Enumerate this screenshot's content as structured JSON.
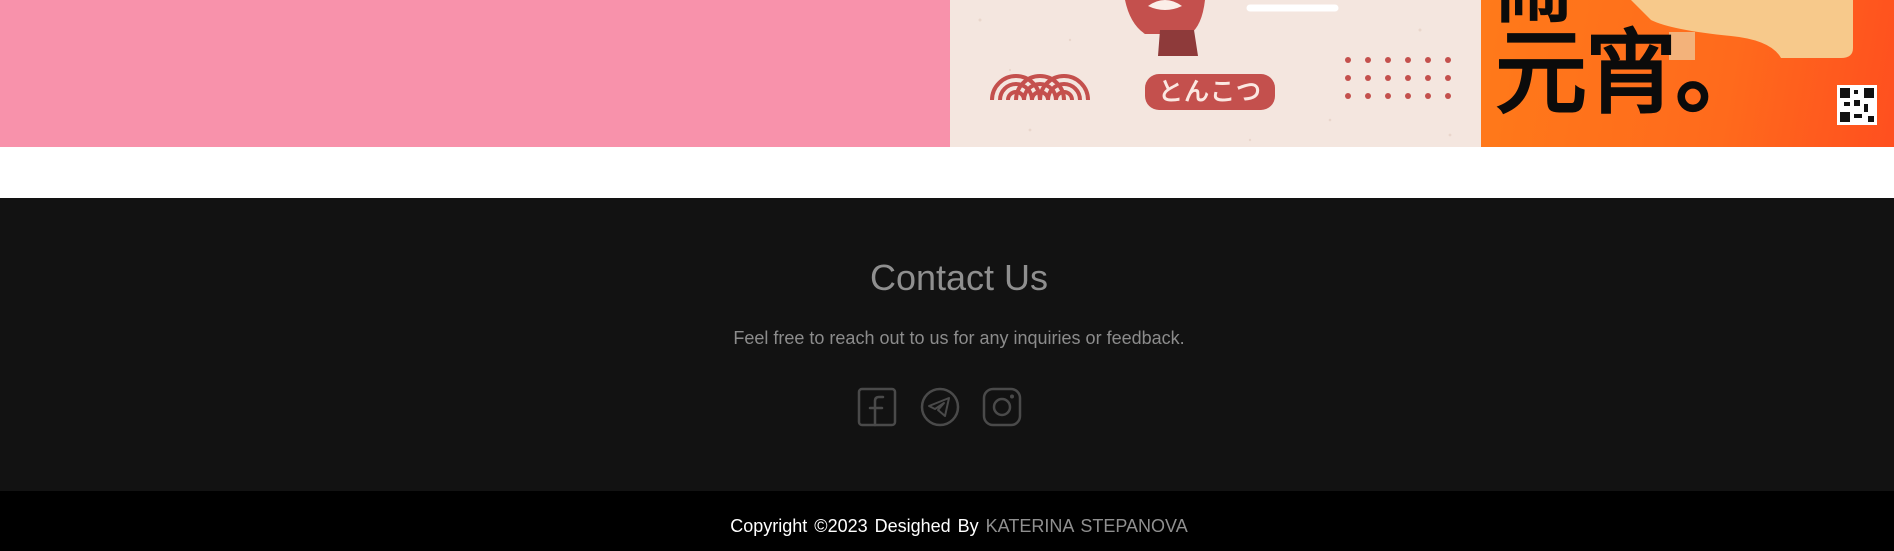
{
  "gallery": {
    "tiles": [
      {
        "name": "pink-panel",
        "color": "#f892ab"
      },
      {
        "name": "ramen-panel",
        "label": "とんこつ",
        "color": "#f4e6df",
        "accent": "#c4504d"
      },
      {
        "name": "orange-panel",
        "text_top": "鬧",
        "text_bottom": "元宵。",
        "color": "#ff6a1c"
      }
    ]
  },
  "contact": {
    "title": "Contact Us",
    "description": "Feel free to reach out to us for any inquiries or feedback.",
    "socials": [
      {
        "icon": "facebook-icon"
      },
      {
        "icon": "telegram-icon"
      },
      {
        "icon": "instagram-icon"
      }
    ],
    "icon_color": "#4a4a4a"
  },
  "footer": {
    "copyright": "Copyright ©2023 Desighed By ",
    "author": "KATERINA STEPANOVA"
  },
  "colors": {
    "footer_bg": "#121212",
    "bottom_bar_bg": "#000000",
    "muted_text": "#8f8f8f"
  }
}
